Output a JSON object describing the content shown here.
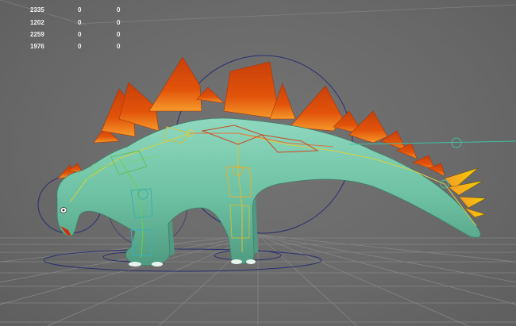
{
  "hud": {
    "rows": [
      {
        "label": "2335",
        "a": "0",
        "b": "0"
      },
      {
        "label": "1202",
        "a": "0",
        "b": "0"
      },
      {
        "label": "2259",
        "a": "0",
        "b": "0"
      },
      {
        "label": "1976",
        "a": "0",
        "b": "0"
      }
    ]
  },
  "scene": {
    "subject": "stegosaurus-rig",
    "colors": {
      "background": "#6b6b6b",
      "grid": "#858585",
      "body": "#6cc0a2",
      "body_shadow": "#4f9a80",
      "plates": "#e2530a",
      "plate_highlight": "#f59a2a",
      "tail_spikes": "#f5b800",
      "rig_control": "#2a2f6e",
      "rig_joint": "#d8d040",
      "hud_text": "#f2f2f2"
    }
  }
}
